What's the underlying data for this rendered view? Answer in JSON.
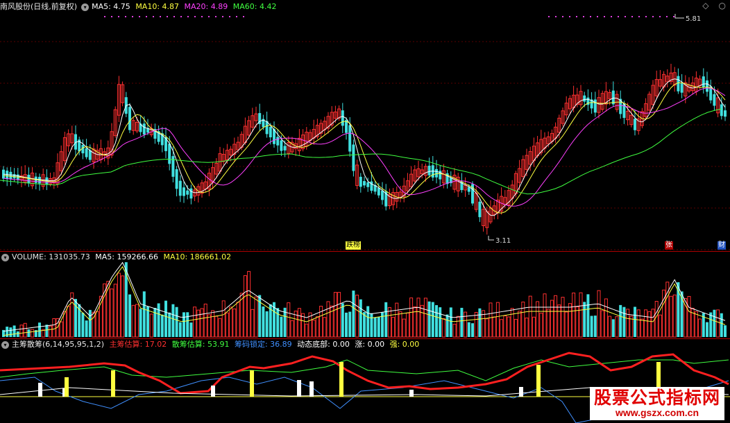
{
  "main": {
    "title": "南风股份(日线,前复权)",
    "ma5": "MA5: 4.75",
    "ma10": "MA10: 4.87",
    "ma20": "MA20: 4.89",
    "ma60": "MA60: 4.42",
    "high_label": "5.81",
    "low_label": "3.11",
    "markers": [
      "跌榜",
      "张",
      "财"
    ]
  },
  "volume": {
    "label": "VOLUME: 131035.73",
    "ma5": "MA5: 159266.66",
    "ma10": "MA10: 186661.02"
  },
  "indicator": {
    "name": "主筹散筹",
    "params": "(6,14,95,95,1,2)",
    "main_chip": "主筹估算: 17.02",
    "scatter_chip": "散筹估算: 53.91",
    "lock_chip": "筹码锁定: 36.89",
    "dynamic_bottom": "动态底部: 0.00",
    "rise": "涨: 0.00",
    "strong": "强: 0.00"
  },
  "watermark": {
    "line1": "股票公式指标网",
    "line2": "www.gszx.com.cn"
  },
  "colors": {
    "up": "#ff3030",
    "down": "#40e0e0",
    "ma5": "#ffffff",
    "ma10": "#ffff40",
    "ma20": "#ff40ff",
    "ma60": "#40ff40"
  }
}
